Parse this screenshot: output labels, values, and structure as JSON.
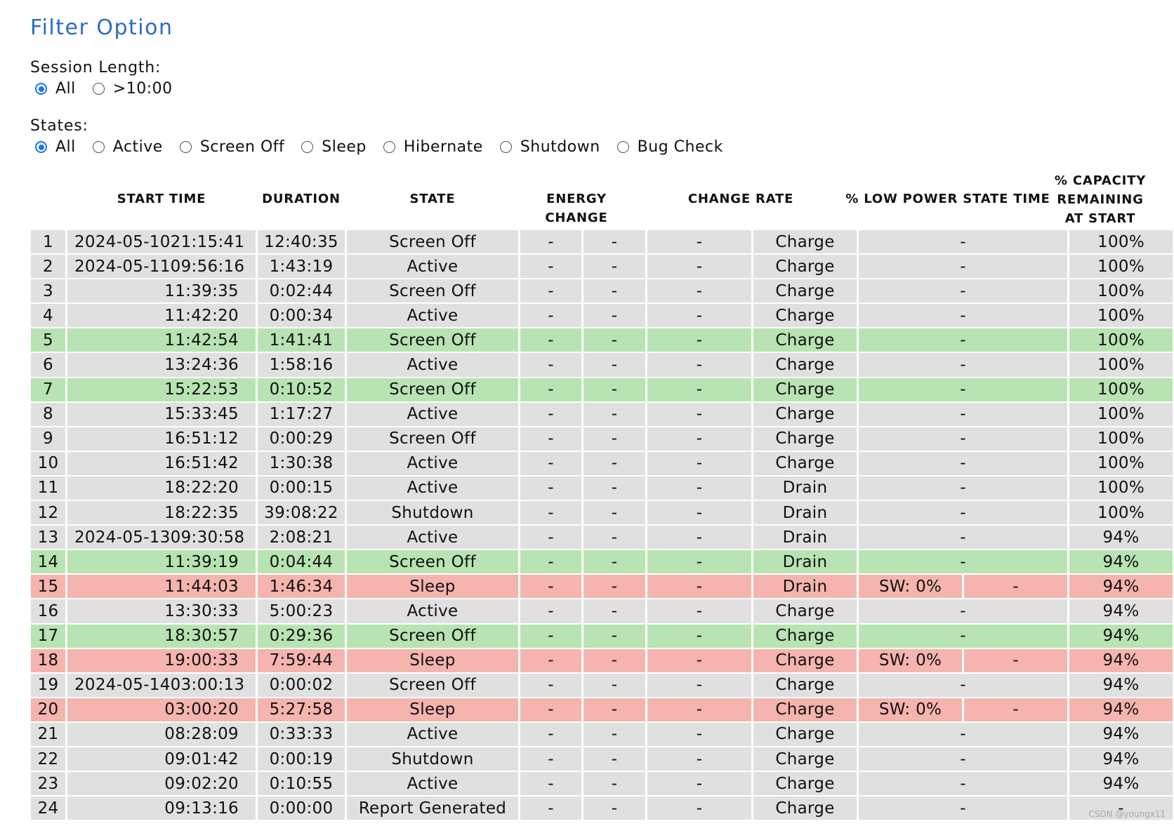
{
  "page_title": "Filter Option",
  "session_length": {
    "label": "Session Length:",
    "options": [
      "All",
      ">10:00"
    ],
    "selected": "All"
  },
  "states": {
    "label": "States:",
    "options": [
      "All",
      "Active",
      "Screen Off",
      "Sleep",
      "Hibernate",
      "Shutdown",
      "Bug Check"
    ],
    "selected": "All"
  },
  "table": {
    "headers": {
      "start_time": "START TIME",
      "duration": "DURATION",
      "state": "STATE",
      "energy_change": "ENERGY CHANGE",
      "change_rate": "CHANGE RATE",
      "low_power": "% LOW POWER STATE TIME",
      "capacity_1": "% CAPACITY",
      "capacity_2": "REMAINING",
      "capacity_3": "AT START"
    },
    "rows": [
      {
        "n": "1",
        "date": "2024-05-10",
        "time": "21:15:41",
        "dur": "12:40:35",
        "state": "Screen Off",
        "e1": "-",
        "e2": "-",
        "rate": "-",
        "mode": "Charge",
        "lp": "-",
        "lp2": "",
        "cap": "100%",
        "hl": ""
      },
      {
        "n": "2",
        "date": "2024-05-11",
        "time": "09:56:16",
        "dur": "1:43:19",
        "state": "Active",
        "e1": "-",
        "e2": "-",
        "rate": "-",
        "mode": "Charge",
        "lp": "-",
        "lp2": "",
        "cap": "100%",
        "hl": ""
      },
      {
        "n": "3",
        "date": "",
        "time": "11:39:35",
        "dur": "0:02:44",
        "state": "Screen Off",
        "e1": "-",
        "e2": "-",
        "rate": "-",
        "mode": "Charge",
        "lp": "-",
        "lp2": "",
        "cap": "100%",
        "hl": ""
      },
      {
        "n": "4",
        "date": "",
        "time": "11:42:20",
        "dur": "0:00:34",
        "state": "Active",
        "e1": "-",
        "e2": "-",
        "rate": "-",
        "mode": "Charge",
        "lp": "-",
        "lp2": "",
        "cap": "100%",
        "hl": ""
      },
      {
        "n": "5",
        "date": "",
        "time": "11:42:54",
        "dur": "1:41:41",
        "state": "Screen Off",
        "e1": "-",
        "e2": "-",
        "rate": "-",
        "mode": "Charge",
        "lp": "-",
        "lp2": "",
        "cap": "100%",
        "hl": "green"
      },
      {
        "n": "6",
        "date": "",
        "time": "13:24:36",
        "dur": "1:58:16",
        "state": "Active",
        "e1": "-",
        "e2": "-",
        "rate": "-",
        "mode": "Charge",
        "lp": "-",
        "lp2": "",
        "cap": "100%",
        "hl": ""
      },
      {
        "n": "7",
        "date": "",
        "time": "15:22:53",
        "dur": "0:10:52",
        "state": "Screen Off",
        "e1": "-",
        "e2": "-",
        "rate": "-",
        "mode": "Charge",
        "lp": "-",
        "lp2": "",
        "cap": "100%",
        "hl": "green"
      },
      {
        "n": "8",
        "date": "",
        "time": "15:33:45",
        "dur": "1:17:27",
        "state": "Active",
        "e1": "-",
        "e2": "-",
        "rate": "-",
        "mode": "Charge",
        "lp": "-",
        "lp2": "",
        "cap": "100%",
        "hl": ""
      },
      {
        "n": "9",
        "date": "",
        "time": "16:51:12",
        "dur": "0:00:29",
        "state": "Screen Off",
        "e1": "-",
        "e2": "-",
        "rate": "-",
        "mode": "Charge",
        "lp": "-",
        "lp2": "",
        "cap": "100%",
        "hl": ""
      },
      {
        "n": "10",
        "date": "",
        "time": "16:51:42",
        "dur": "1:30:38",
        "state": "Active",
        "e1": "-",
        "e2": "-",
        "rate": "-",
        "mode": "Charge",
        "lp": "-",
        "lp2": "",
        "cap": "100%",
        "hl": ""
      },
      {
        "n": "11",
        "date": "",
        "time": "18:22:20",
        "dur": "0:00:15",
        "state": "Active",
        "e1": "-",
        "e2": "-",
        "rate": "-",
        "mode": "Drain",
        "lp": "-",
        "lp2": "",
        "cap": "100%",
        "hl": ""
      },
      {
        "n": "12",
        "date": "",
        "time": "18:22:35",
        "dur": "39:08:22",
        "state": "Shutdown",
        "e1": "-",
        "e2": "-",
        "rate": "-",
        "mode": "Drain",
        "lp": "-",
        "lp2": "",
        "cap": "100%",
        "hl": ""
      },
      {
        "n": "13",
        "date": "2024-05-13",
        "time": "09:30:58",
        "dur": "2:08:21",
        "state": "Active",
        "e1": "-",
        "e2": "-",
        "rate": "-",
        "mode": "Drain",
        "lp": "-",
        "lp2": "",
        "cap": "94%",
        "hl": ""
      },
      {
        "n": "14",
        "date": "",
        "time": "11:39:19",
        "dur": "0:04:44",
        "state": "Screen Off",
        "e1": "-",
        "e2": "-",
        "rate": "-",
        "mode": "Drain",
        "lp": "-",
        "lp2": "",
        "cap": "94%",
        "hl": "green"
      },
      {
        "n": "15",
        "date": "",
        "time": "11:44:03",
        "dur": "1:46:34",
        "state": "Sleep",
        "e1": "-",
        "e2": "-",
        "rate": "-",
        "mode": "Drain",
        "lp": "SW: 0%",
        "lp2": "-",
        "cap": "94%",
        "hl": "red"
      },
      {
        "n": "16",
        "date": "",
        "time": "13:30:33",
        "dur": "5:00:23",
        "state": "Active",
        "e1": "-",
        "e2": "-",
        "rate": "-",
        "mode": "Charge",
        "lp": "-",
        "lp2": "",
        "cap": "94%",
        "hl": ""
      },
      {
        "n": "17",
        "date": "",
        "time": "18:30:57",
        "dur": "0:29:36",
        "state": "Screen Off",
        "e1": "-",
        "e2": "-",
        "rate": "-",
        "mode": "Charge",
        "lp": "-",
        "lp2": "",
        "cap": "94%",
        "hl": "green"
      },
      {
        "n": "18",
        "date": "",
        "time": "19:00:33",
        "dur": "7:59:44",
        "state": "Sleep",
        "e1": "-",
        "e2": "-",
        "rate": "-",
        "mode": "Charge",
        "lp": "SW: 0%",
        "lp2": "-",
        "cap": "94%",
        "hl": "red"
      },
      {
        "n": "19",
        "date": "2024-05-14",
        "time": "03:00:13",
        "dur": "0:00:02",
        "state": "Screen Off",
        "e1": "-",
        "e2": "-",
        "rate": "-",
        "mode": "Charge",
        "lp": "-",
        "lp2": "",
        "cap": "94%",
        "hl": ""
      },
      {
        "n": "20",
        "date": "",
        "time": "03:00:20",
        "dur": "5:27:58",
        "state": "Sleep",
        "e1": "-",
        "e2": "-",
        "rate": "-",
        "mode": "Charge",
        "lp": "SW: 0%",
        "lp2": "-",
        "cap": "94%",
        "hl": "red"
      },
      {
        "n": "21",
        "date": "",
        "time": "08:28:09",
        "dur": "0:33:33",
        "state": "Active",
        "e1": "-",
        "e2": "-",
        "rate": "-",
        "mode": "Charge",
        "lp": "-",
        "lp2": "",
        "cap": "94%",
        "hl": ""
      },
      {
        "n": "22",
        "date": "",
        "time": "09:01:42",
        "dur": "0:00:19",
        "state": "Shutdown",
        "e1": "-",
        "e2": "-",
        "rate": "-",
        "mode": "Charge",
        "lp": "-",
        "lp2": "",
        "cap": "94%",
        "hl": ""
      },
      {
        "n": "23",
        "date": "",
        "time": "09:02:20",
        "dur": "0:10:55",
        "state": "Active",
        "e1": "-",
        "e2": "-",
        "rate": "-",
        "mode": "Charge",
        "lp": "-",
        "lp2": "",
        "cap": "94%",
        "hl": ""
      },
      {
        "n": "24",
        "date": "",
        "time": "09:13:16",
        "dur": "0:00:00",
        "state": "Report Generated",
        "e1": "-",
        "e2": "-",
        "rate": "-",
        "mode": "Charge",
        "lp": "-",
        "lp2": "",
        "cap": "-",
        "hl": ""
      }
    ]
  },
  "watermark": "CSDN @youngx11",
  "colors": {
    "accent": "#2b6cc4",
    "radio": "#1a73e8",
    "row_default": "#e0e0e0",
    "row_green": "#b8e3b3",
    "row_red": "#f5b4ae"
  }
}
